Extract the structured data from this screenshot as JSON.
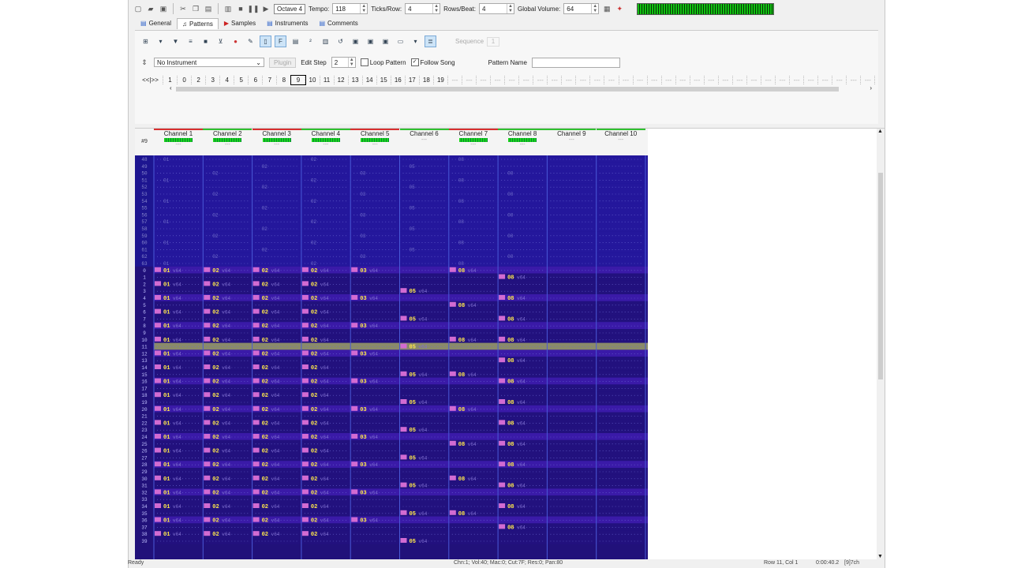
{
  "toolbar": {
    "octave": "Octave 4",
    "tempo_label": "Tempo:",
    "tempo_value": "118",
    "ticks_label": "Ticks/Row:",
    "ticks_value": "4",
    "rows_label": "Rows/Beat:",
    "rows_value": "4",
    "volume_label": "Global Volume:",
    "volume_value": "64"
  },
  "tabs": [
    {
      "label": "General",
      "icon": "info-icon"
    },
    {
      "label": "Patterns",
      "icon": "note-icon"
    },
    {
      "label": "Samples",
      "icon": "arrow-icon"
    },
    {
      "label": "Instruments",
      "icon": "list-icon"
    },
    {
      "label": "Comments",
      "icon": "doc-icon"
    }
  ],
  "patterns_panel": {
    "sequence_label": "Sequence",
    "sequence_value": "1",
    "instrument": "No Instrument",
    "plugin_label": "Plugin",
    "edit_step_label": "Edit Step",
    "edit_step_value": "2",
    "loop_pattern": "Loop Pattern",
    "follow_song": "Follow Song",
    "pattern_name_label": "Pattern Name",
    "nav_label": "<<|>>",
    "orders": [
      "1",
      "0",
      "2",
      "3",
      "4",
      "5",
      "6",
      "7",
      "8",
      "9",
      "10",
      "11",
      "12",
      "13",
      "14",
      "15",
      "16",
      "17",
      "18",
      "19"
    ],
    "selected_order": "9"
  },
  "channels": [
    {
      "name": "Channel 1",
      "color": "#d83030",
      "active": true
    },
    {
      "name": "Channel 2",
      "color": "#30c030",
      "active": true
    },
    {
      "name": "Channel 3",
      "color": "#d83030",
      "active": true
    },
    {
      "name": "Channel 4",
      "color": "#30c030",
      "active": true
    },
    {
      "name": "Channel 5",
      "color": "#d83030",
      "active": true
    },
    {
      "name": "Channel 6",
      "color": "#30c030",
      "active": false
    },
    {
      "name": "Channel 7",
      "color": "#d83030",
      "active": true
    },
    {
      "name": "Channel 8",
      "color": "#30c030",
      "active": true
    },
    {
      "name": "Channel 9",
      "color": "#30c030",
      "active": false
    },
    {
      "name": "Channel 10",
      "color": "#30c030",
      "active": false
    }
  ],
  "grid": {
    "header_label": "#9",
    "prev_rows": [
      "48",
      "49",
      "50",
      "51",
      "52",
      "53",
      "54",
      "55",
      "56",
      "57",
      "58",
      "59",
      "60",
      "61",
      "62",
      "63"
    ],
    "rows": [
      "0",
      "1",
      "2",
      "3",
      "4",
      "5",
      "6",
      "7",
      "8",
      "9",
      "10",
      "11",
      "12",
      "13",
      "14",
      "15",
      "16",
      "17",
      "18",
      "19",
      "20",
      "21",
      "22",
      "23",
      "24",
      "25",
      "26",
      "27",
      "28",
      "29",
      "30",
      "31",
      "32",
      "33",
      "34",
      "35",
      "36",
      "37",
      "38",
      "39"
    ],
    "current_row": "11"
  },
  "status": {
    "left": "Ready",
    "middle": "Chn:1; Vol:40; Mac:0; Cut:7F; Res:0; Pan:80",
    "row_col": "Row 11, Col 1",
    "time": "0:00:40.2",
    "channels": "[9]7ch"
  }
}
